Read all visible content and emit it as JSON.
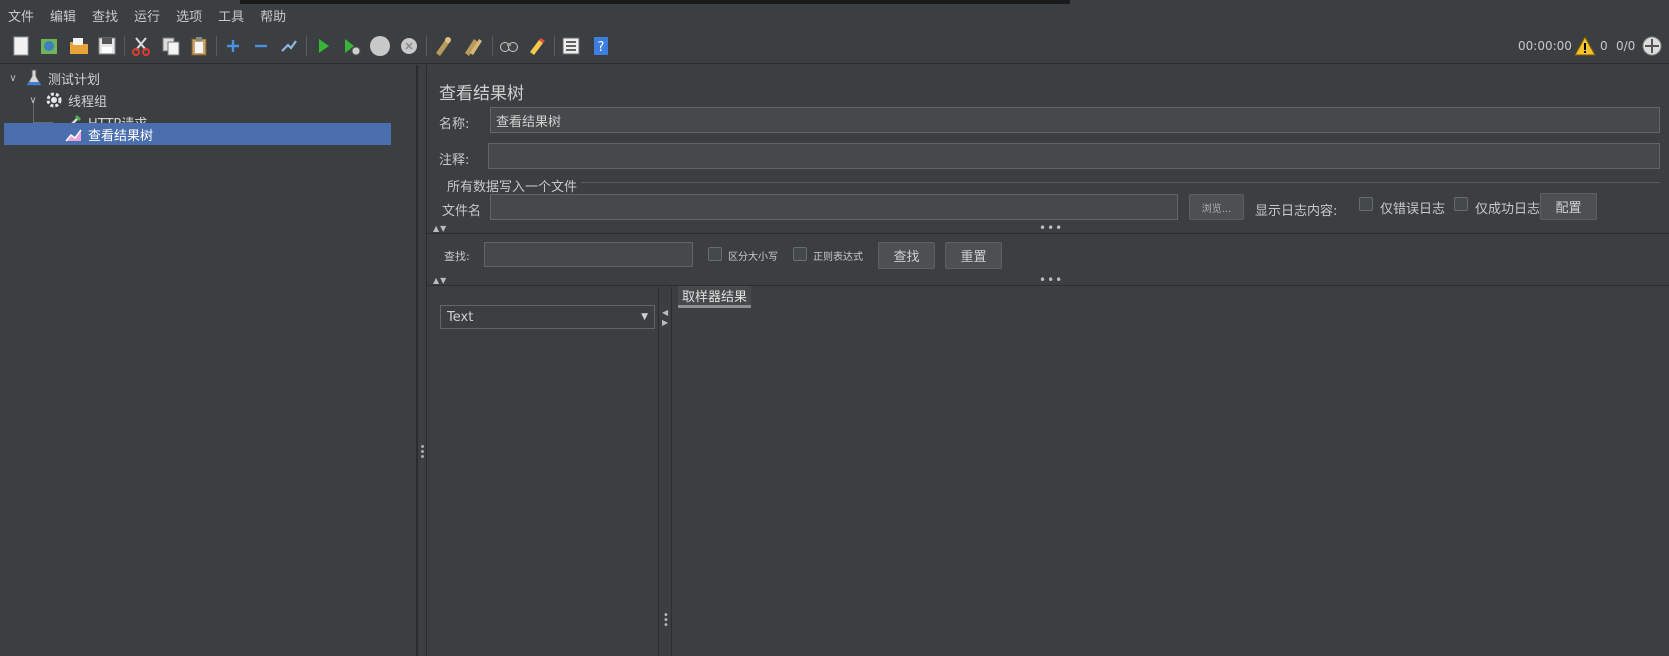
{
  "menu": [
    "文件",
    "编辑",
    "查找",
    "运行",
    "选项",
    "工具",
    "帮助"
  ],
  "toolbar": {
    "icons": [
      "new-icon",
      "templates-icon",
      "open-icon",
      "save-icon",
      "cut-icon",
      "copy-icon",
      "paste-icon",
      "expand-icon",
      "collapse-icon",
      "toggle-icon",
      "start-icon",
      "start-no-pause-icon",
      "stop-icon",
      "shutdown-icon",
      "clear-icon",
      "clear-all-icon",
      "search-icon",
      "reset-search-icon",
      "function-helper-icon",
      "help-icon"
    ]
  },
  "status": {
    "time": "00:00:00",
    "warn_count": "0",
    "threads": "0/0"
  },
  "tree": {
    "items": [
      {
        "label": "测试计划",
        "icon": "test-plan-icon"
      },
      {
        "label": "线程组",
        "icon": "thread-group-icon"
      },
      {
        "label": "HTTP请求",
        "icon": "http-request-icon"
      },
      {
        "label": "查看结果树",
        "icon": "result-tree-icon"
      }
    ]
  },
  "panel": {
    "title": "查看结果树",
    "name_label": "名称:",
    "name_value": "查看结果树",
    "comment_label": "注释:",
    "comment_value": "",
    "file_group_title": "所有数据写入一个文件",
    "filename_label": "文件名",
    "filename_value": "",
    "browse_button": "浏览...",
    "log_content_label": "显示日志内容:",
    "errors_only_label": "仅错误日志",
    "success_only_label": "仅成功日志",
    "configure_button": "配置",
    "search_label": "查找:",
    "search_value": "",
    "case_sensitive_label": "区分大小写",
    "regex_label": "正则表达式",
    "search_button": "查找",
    "reset_button": "重置",
    "renderer_selected": "Text",
    "result_tab": "取样器结果"
  },
  "colors": {
    "background": "#3c3f41",
    "selection": "#4b6eaf",
    "field": "#45494a"
  }
}
